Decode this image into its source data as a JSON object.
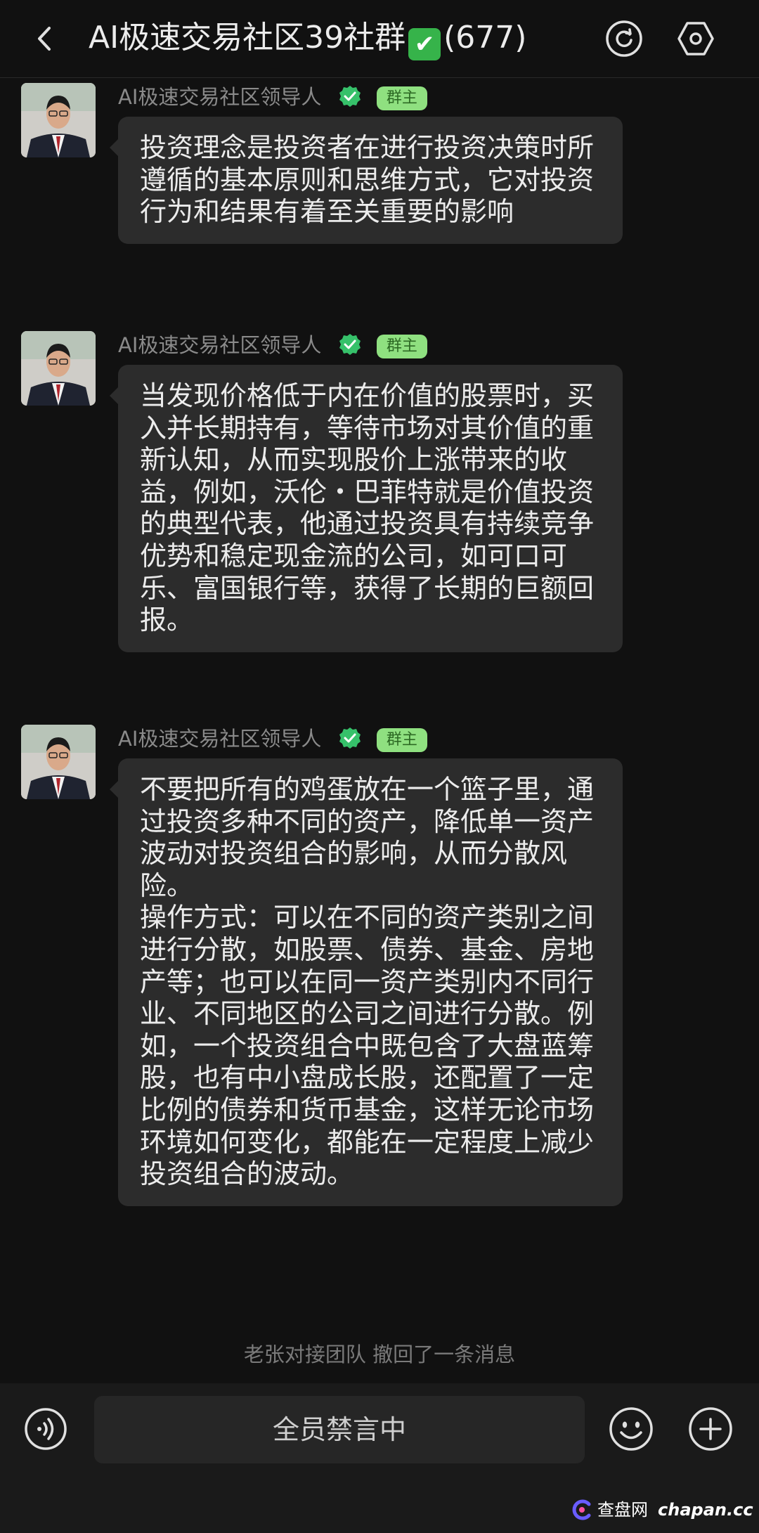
{
  "header": {
    "title": "AI极速交易社区39社群",
    "title_emoji": "✔",
    "member_count": "(677)"
  },
  "messages": [
    {
      "sender": "AI极速交易社区领导人",
      "role": "群主",
      "text": "投资理念是投资者在进行投资决策时所遵循的基本原则和思维方式，它对投资行为和结果有着至关重要的影响"
    },
    {
      "sender": "AI极速交易社区领导人",
      "role": "群主",
      "text": "当发现价格低于内在价值的股票时，买入并长期持有，等待市场对其价值的重新认知，从而实现股价上涨带来的收益，例如，沃伦・巴菲特就是价值投资的典型代表，他通过投资具有持续竞争优势和稳定现金流的公司，如可口可乐、富国银行等，获得了长期的巨额回报。"
    },
    {
      "sender": "AI极速交易社区领导人",
      "role": "群主",
      "text": "不要把所有的鸡蛋放在一个篮子里，通过投资多种不同的资产，降低单一资产波动对投资组合的影响，从而分散风险。\n操作方式：可以在不同的资产类别之间进行分散，如股票、债券、基金、房地产等；也可以在同一资产类别内不同行业、不同地区的公司之间进行分散。例如，一个投资组合中既包含了大盘蓝筹股，也有中小盘成长股，还配置了一定比例的债券和货币基金，这样无论市场环境如何变化，都能在一定程度上减少投资组合的波动。"
    }
  ],
  "system_note": "老张对接团队 撤回了一条消息",
  "input_bar": {
    "muted_text": "全员禁言中"
  },
  "watermark": {
    "name": "查盘网",
    "domain": "chapan.cc"
  },
  "colors": {
    "background": "#111111",
    "bubble": "#2c2c2c",
    "verified_green": "#36c16a",
    "badge_bg": "#8fe080",
    "badge_text": "#2d6a24"
  },
  "icons": {
    "back": "chevron-left",
    "refresh": "refresh-circle",
    "settings": "hexagon-settings",
    "voice": "voice-wave",
    "emoji": "smiley",
    "plus": "plus-circle",
    "verified": "verified-badge"
  }
}
